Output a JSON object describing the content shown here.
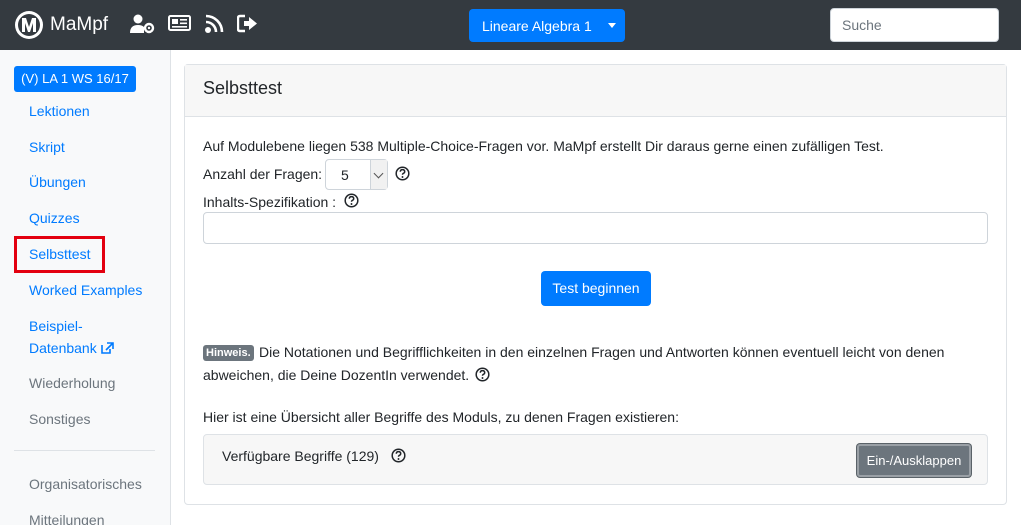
{
  "navbar": {
    "brand": "MaMpf",
    "icons": [
      "user-gear-icon",
      "news-icon",
      "feed-icon",
      "logout-icon"
    ],
    "course_selector": "Lineare Algebra 1",
    "search_placeholder": "Suche"
  },
  "sidebar": {
    "course_badge": "(V) LA 1 WS 16/17",
    "items": [
      {
        "label": "Lektionen",
        "style": "link"
      },
      {
        "label": "Skript",
        "style": "link"
      },
      {
        "label": "Übungen",
        "style": "link"
      },
      {
        "label": "Quizzes",
        "style": "link"
      },
      {
        "label": "Selbsttest",
        "style": "link",
        "highlighted": true
      },
      {
        "label": "Worked Examples",
        "style": "link"
      },
      {
        "label": "Beispiel-",
        "label_line2": "Datenbank",
        "style": "link",
        "external": true
      },
      {
        "label": "Wiederholung",
        "style": "muted"
      },
      {
        "label": "Sonstiges",
        "style": "muted"
      },
      {
        "label": "Organisatorisches",
        "style": "muted"
      },
      {
        "label": "Mitteilungen",
        "style": "muted"
      }
    ]
  },
  "main": {
    "title": "Selbsttest",
    "intro": "Auf Modulebene liegen 538 Multiple-Choice-Fragen vor. MaMpf erstellt Dir daraus gerne einen zufälligen Test.",
    "question_count_label": "Anzahl der Fragen:",
    "question_count_value": "5",
    "content_spec_label": "Inhalts-Spezifikation :",
    "start_button": "Test beginnen",
    "hint_badge": "Hinweis.",
    "hint_line1": "Die Notationen und Begrifflichkeiten in den einzelnen Fragen und Antworten können eventuell leicht von denen",
    "hint_line2": "abweichen, die Deine DozentIn verwendet.",
    "overview_text": "Hier ist eine Übersicht aller Begriffe des Moduls, zu denen Fragen existieren:",
    "terms_label": "Verfügbare Begriffe (129)",
    "toggle_button": "Ein-/Ausklappen"
  },
  "colors": {
    "navbar": "#343a40",
    "primary": "#007bff",
    "highlight_box": "#e3000f",
    "secondary": "#6c757d"
  }
}
